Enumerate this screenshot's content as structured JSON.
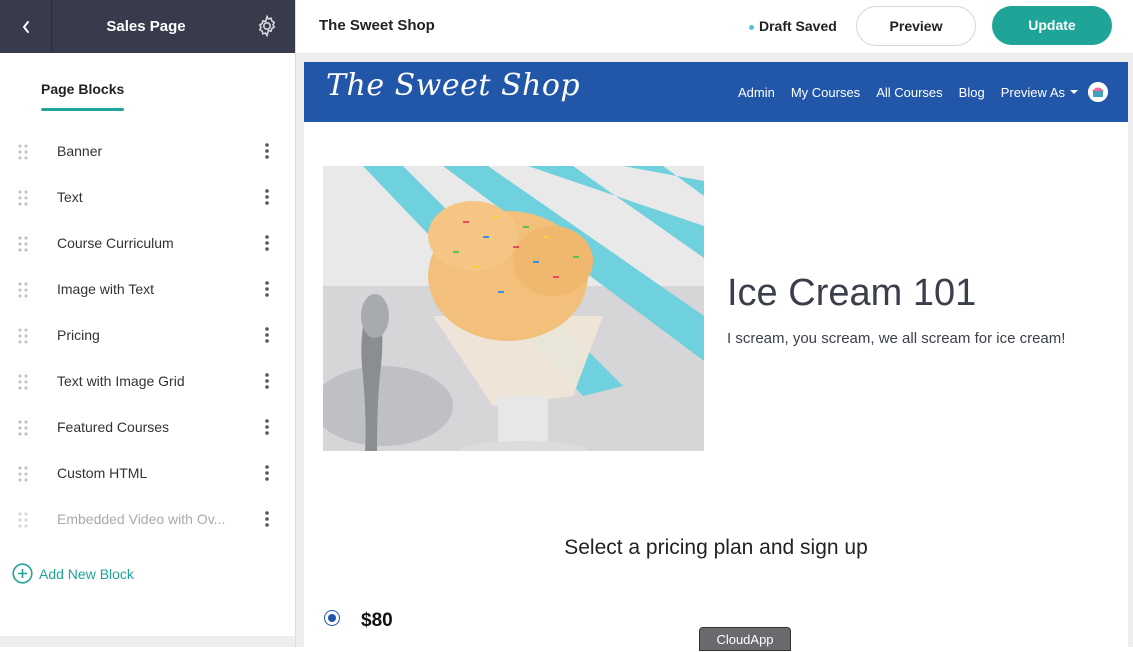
{
  "sidebar": {
    "title": "Sales Page",
    "tab_label": "Page Blocks",
    "blocks": [
      {
        "label": "Banner"
      },
      {
        "label": "Text"
      },
      {
        "label": "Course Curriculum"
      },
      {
        "label": "Image with Text"
      },
      {
        "label": "Pricing"
      },
      {
        "label": "Text with Image Grid"
      },
      {
        "label": "Featured Courses"
      },
      {
        "label": "Custom HTML"
      },
      {
        "label": "Embedded Video with Ov..."
      }
    ],
    "add_block_label": "Add New Block"
  },
  "topbar": {
    "site_name": "The Sweet Shop",
    "status": "Draft Saved",
    "preview_label": "Preview",
    "update_label": "Update"
  },
  "preview": {
    "logo_text": "The Sweet Shop",
    "nav": {
      "admin": "Admin",
      "my_courses": "My Courses",
      "all_courses": "All Courses",
      "blog": "Blog",
      "preview_as": "Preview As"
    },
    "hero_title": "Ice Cream 101",
    "hero_subtitle": "I scream, you scream, we all scream for ice cream!",
    "pricing_heading": "Select a pricing plan and sign up",
    "price": "$80"
  },
  "overlay": {
    "cloudapp_label": "CloudApp"
  },
  "colors": {
    "sidebar_header": "#383b4b",
    "accent_teal": "#1fa598",
    "site_nav_blue": "#2156a9"
  }
}
